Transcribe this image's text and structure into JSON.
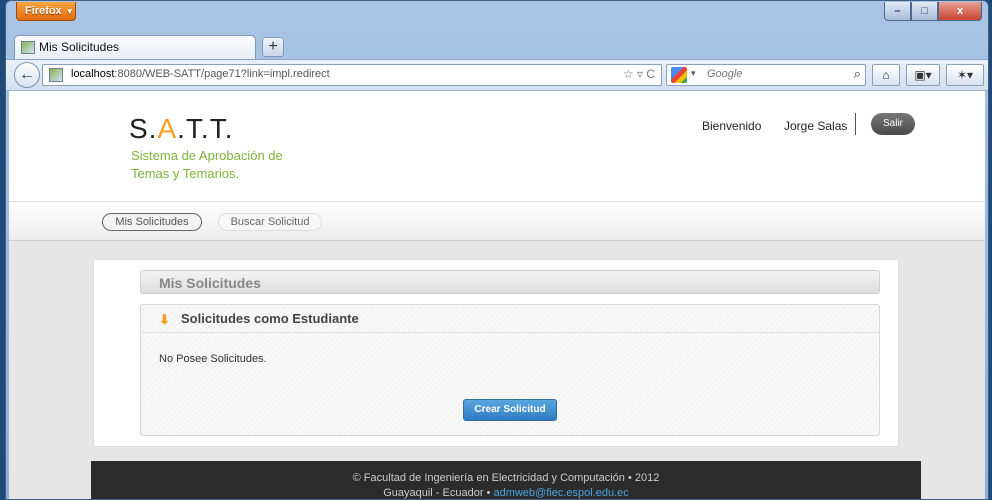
{
  "browser": {
    "app_menu_label": "Firefox",
    "window_controls": {
      "minimize": "–",
      "maximize": "□",
      "close": "x"
    },
    "tab": {
      "title": "Mis Solicitudes",
      "new_tab": "+"
    },
    "address": {
      "host": "localhost",
      "rest": ":8080/WEB-SATT/page71?link=impl.redirect"
    },
    "search": {
      "placeholder": "Google"
    }
  },
  "site": {
    "logo": {
      "s": "S.",
      "a": "A",
      "tt": ".T.T."
    },
    "tagline": "Sistema de Aprobación de Temas y Temarios.",
    "welcome": "Bienvenido",
    "user_name": "Jorge Salas",
    "logout_label": "Salir"
  },
  "subnav": {
    "items": [
      {
        "label": "Mis Solicitudes"
      },
      {
        "label": "Buscar Solicitud"
      }
    ]
  },
  "main": {
    "title": "Mis Solicitudes",
    "panel_title": "Solicitudes como Estudiante",
    "empty_message": "No Posee Solicitudes.",
    "create_button": "Crear Solicitud"
  },
  "footer": {
    "line1": "© Facultad de Ingeniería en Electricidad y Computación • 2012",
    "line2_prefix": "Guayaquil - Ecuador •",
    "email": "admweb@fiec.espol.edu.ec"
  },
  "colors": {
    "accent_orange": "#f2a11f",
    "tagline_green": "#7db33a",
    "button_blue": "#2f7bc0",
    "footer_bg": "#2b2b2b"
  }
}
